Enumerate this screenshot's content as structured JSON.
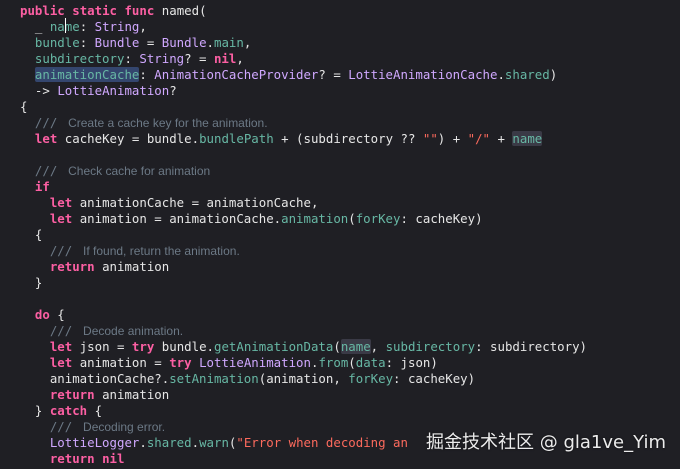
{
  "lines": [
    {
      "tokens": [
        {
          "t": "public",
          "c": "kw"
        },
        {
          "t": " "
        },
        {
          "t": "static",
          "c": "kw"
        },
        {
          "t": " "
        },
        {
          "t": "func",
          "c": "kw"
        },
        {
          "t": " named(",
          "c": "pl"
        }
      ]
    },
    {
      "tokens": [
        {
          "t": "  _ ",
          "c": "pl"
        },
        {
          "t": "name",
          "c": "mem"
        },
        {
          "t": ": ",
          "c": "pl"
        },
        {
          "t": "String",
          "c": "ty"
        },
        {
          "t": ",",
          "c": "pl"
        }
      ]
    },
    {
      "tokens": [
        {
          "t": "  bundle",
          "c": "mem"
        },
        {
          "t": ": ",
          "c": "pl"
        },
        {
          "t": "Bundle",
          "c": "ty"
        },
        {
          "t": " = ",
          "c": "pl"
        },
        {
          "t": "Bundle",
          "c": "ty"
        },
        {
          "t": ".",
          "c": "pl"
        },
        {
          "t": "main",
          "c": "mem"
        },
        {
          "t": ",",
          "c": "pl"
        }
      ]
    },
    {
      "tokens": [
        {
          "t": "  subdirectory",
          "c": "mem"
        },
        {
          "t": ": ",
          "c": "pl"
        },
        {
          "t": "String",
          "c": "ty"
        },
        {
          "t": "? = ",
          "c": "pl"
        },
        {
          "t": "nil",
          "c": "kw"
        },
        {
          "t": ",",
          "c": "pl"
        }
      ]
    },
    {
      "tokens": [
        {
          "t": "  "
        },
        {
          "t": "animationCache",
          "c": "mem hl"
        },
        {
          "t": ": ",
          "c": "pl"
        },
        {
          "t": "AnimationCacheProvider",
          "c": "ty"
        },
        {
          "t": "? = ",
          "c": "pl"
        },
        {
          "t": "LottieAnimationCache",
          "c": "ty"
        },
        {
          "t": ".",
          "c": "pl"
        },
        {
          "t": "shared",
          "c": "mem"
        },
        {
          "t": ")",
          "c": "pl"
        }
      ]
    },
    {
      "tokens": [
        {
          "t": "  -> ",
          "c": "pl"
        },
        {
          "t": "LottieAnimation",
          "c": "ty"
        },
        {
          "t": "?",
          "c": "pl"
        }
      ]
    },
    {
      "tokens": [
        {
          "t": "{",
          "c": "pl"
        }
      ]
    },
    {
      "tokens": [
        {
          "t": "  /// ",
          "c": "cmm"
        },
        {
          "t": " Create a cache key for the animation.",
          "c": "cm"
        }
      ]
    },
    {
      "tokens": [
        {
          "t": "  "
        },
        {
          "t": "let",
          "c": "kw"
        },
        {
          "t": " cacheKey = bundle.",
          "c": "pl"
        },
        {
          "t": "bundlePath",
          "c": "mem"
        },
        {
          "t": " + (subdirectory ?? ",
          "c": "pl"
        },
        {
          "t": "\"\"",
          "c": "str"
        },
        {
          "t": ") + ",
          "c": "pl"
        },
        {
          "t": "\"/\"",
          "c": "str"
        },
        {
          "t": " + ",
          "c": "pl"
        },
        {
          "t": "name",
          "c": "mem hl2"
        }
      ]
    },
    {
      "tokens": [
        {
          "t": ""
        }
      ]
    },
    {
      "tokens": [
        {
          "t": "  /// ",
          "c": "cmm"
        },
        {
          "t": " Check cache for animation",
          "c": "cm"
        }
      ]
    },
    {
      "tokens": [
        {
          "t": "  "
        },
        {
          "t": "if",
          "c": "kw"
        }
      ]
    },
    {
      "tokens": [
        {
          "t": "    "
        },
        {
          "t": "let",
          "c": "kw"
        },
        {
          "t": " animationCache = animationCache,",
          "c": "pl"
        }
      ]
    },
    {
      "tokens": [
        {
          "t": "    "
        },
        {
          "t": "let",
          "c": "kw"
        },
        {
          "t": " animation = animationCache.",
          "c": "pl"
        },
        {
          "t": "animation",
          "c": "mem"
        },
        {
          "t": "(",
          "c": "pl"
        },
        {
          "t": "forKey",
          "c": "mem"
        },
        {
          "t": ": cacheKey)",
          "c": "pl"
        }
      ]
    },
    {
      "tokens": [
        {
          "t": "  {",
          "c": "pl"
        }
      ]
    },
    {
      "tokens": [
        {
          "t": "    /// ",
          "c": "cmm"
        },
        {
          "t": " If found, return the animation.",
          "c": "cm"
        }
      ]
    },
    {
      "tokens": [
        {
          "t": "    "
        },
        {
          "t": "return",
          "c": "kw"
        },
        {
          "t": " animation",
          "c": "pl"
        }
      ]
    },
    {
      "tokens": [
        {
          "t": "  }",
          "c": "pl"
        }
      ]
    },
    {
      "tokens": [
        {
          "t": ""
        }
      ]
    },
    {
      "tokens": [
        {
          "t": "  "
        },
        {
          "t": "do",
          "c": "kw"
        },
        {
          "t": " {",
          "c": "pl"
        }
      ]
    },
    {
      "tokens": [
        {
          "t": "    /// ",
          "c": "cmm"
        },
        {
          "t": " Decode animation.",
          "c": "cm"
        }
      ]
    },
    {
      "tokens": [
        {
          "t": "    "
        },
        {
          "t": "let",
          "c": "kw"
        },
        {
          "t": " json = ",
          "c": "pl"
        },
        {
          "t": "try",
          "c": "kw"
        },
        {
          "t": " bundle.",
          "c": "pl"
        },
        {
          "t": "getAnimationData",
          "c": "mem"
        },
        {
          "t": "(",
          "c": "pl"
        },
        {
          "t": "name",
          "c": "mem hl2"
        },
        {
          "t": ", ",
          "c": "pl"
        },
        {
          "t": "subdirectory",
          "c": "mem"
        },
        {
          "t": ": subdirectory)",
          "c": "pl"
        }
      ]
    },
    {
      "tokens": [
        {
          "t": "    "
        },
        {
          "t": "let",
          "c": "kw"
        },
        {
          "t": " animation = ",
          "c": "pl"
        },
        {
          "t": "try",
          "c": "kw"
        },
        {
          "t": " ",
          "c": "pl"
        },
        {
          "t": "LottieAnimation",
          "c": "ty"
        },
        {
          "t": ".",
          "c": "pl"
        },
        {
          "t": "from",
          "c": "mem"
        },
        {
          "t": "(",
          "c": "pl"
        },
        {
          "t": "data",
          "c": "mem"
        },
        {
          "t": ": json)",
          "c": "pl"
        }
      ]
    },
    {
      "tokens": [
        {
          "t": "    animationCache?.",
          "c": "pl"
        },
        {
          "t": "setAnimation",
          "c": "mem"
        },
        {
          "t": "(animation, ",
          "c": "pl"
        },
        {
          "t": "forKey",
          "c": "mem"
        },
        {
          "t": ": cacheKey)",
          "c": "pl"
        }
      ]
    },
    {
      "tokens": [
        {
          "t": "    "
        },
        {
          "t": "return",
          "c": "kw"
        },
        {
          "t": " animation",
          "c": "pl"
        }
      ]
    },
    {
      "tokens": [
        {
          "t": "  } ",
          "c": "pl"
        },
        {
          "t": "catch",
          "c": "kw"
        },
        {
          "t": " {",
          "c": "pl"
        }
      ]
    },
    {
      "tokens": [
        {
          "t": "    /// ",
          "c": "cmm"
        },
        {
          "t": " Decoding error.",
          "c": "cm"
        }
      ]
    },
    {
      "tokens": [
        {
          "t": "    "
        },
        {
          "t": "LottieLogger",
          "c": "ty"
        },
        {
          "t": ".",
          "c": "pl"
        },
        {
          "t": "shared",
          "c": "mem"
        },
        {
          "t": ".",
          "c": "pl"
        },
        {
          "t": "warn",
          "c": "mem"
        },
        {
          "t": "(",
          "c": "pl"
        },
        {
          "t": "\"Error when decoding an",
          "c": "str"
        }
      ]
    },
    {
      "tokens": [
        {
          "t": "    "
        },
        {
          "t": "return",
          "c": "kw"
        },
        {
          "t": " ",
          "c": "pl"
        },
        {
          "t": "nil",
          "c": "kw"
        }
      ]
    }
  ],
  "watermark": "掘金技术社区 @ gla1ve_Yim"
}
